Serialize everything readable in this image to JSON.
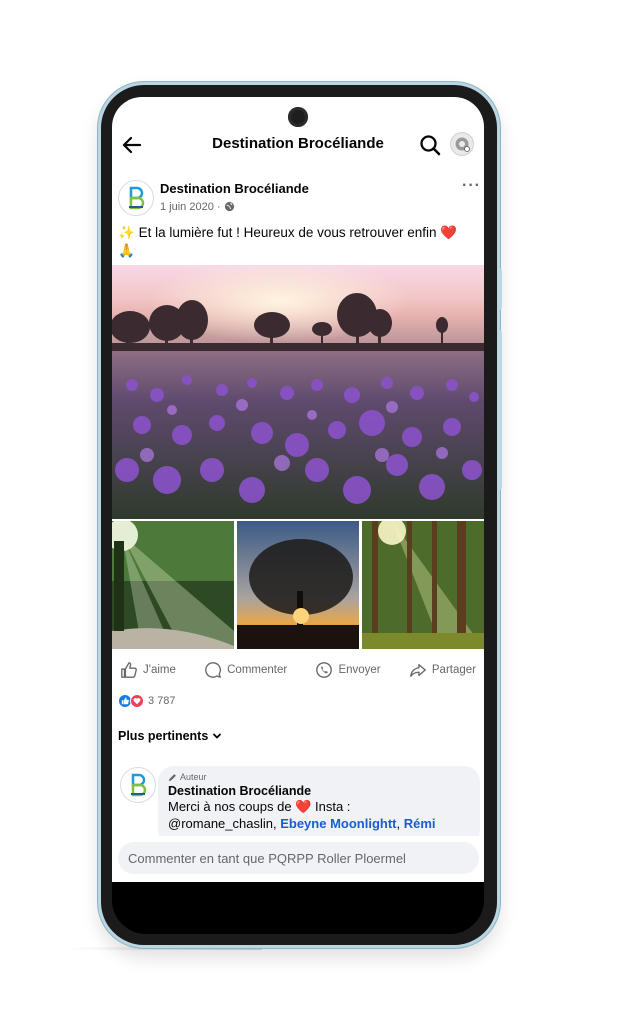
{
  "header": {
    "title": "Destination Brocéliande"
  },
  "post": {
    "author": "Destination Brocéliande",
    "date": "1 juin 2020 ·",
    "text": "Et la lumière fut ! Heureux de vous retrouver enfin",
    "more_label": "···"
  },
  "actions": {
    "like": "J'aime",
    "comment": "Commenter",
    "send": "Envoyer",
    "share": "Partager"
  },
  "reactions": {
    "count": "3 787"
  },
  "sort": {
    "label": "Plus pertinents"
  },
  "comment": {
    "badge": "Auteur",
    "author": "Destination Brocéliande",
    "text_before": "Merci à nos coups de",
    "text_after": "Insta :",
    "line2_start": "@romane_chaslin,",
    "mention1": "Ebeyne Moonlightt",
    "comma": ",",
    "mention2": "Rémi"
  },
  "composer": {
    "placeholder": "Commenter en tant que PQRPP Roller Ploermel"
  },
  "colors": {
    "accent": "#1877f2",
    "heart": "#e0242b",
    "mention": "#1b5dd1",
    "secondary_text": "#65676b",
    "phone_frame": "#b9d6e2"
  },
  "icons": [
    "back-arrow-icon",
    "search-icon",
    "globe-icon",
    "sparkles-icon",
    "heart-icon",
    "pray-icon",
    "like-icon",
    "comment-icon",
    "whatsapp-icon",
    "share-icon",
    "like-reaction-icon",
    "love-reaction-icon",
    "chevron-down-icon",
    "pencil-icon"
  ]
}
